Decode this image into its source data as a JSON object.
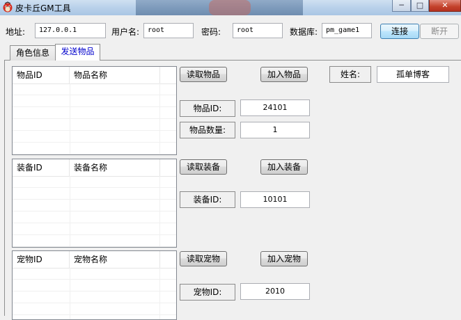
{
  "window": {
    "title": "皮卡丘GM工具",
    "minimize": "─",
    "maximize": "□",
    "close": "✕"
  },
  "connection": {
    "address_label": "地址:",
    "address_value": "127.0.0.1",
    "user_label": "用户名:",
    "user_value": "root",
    "password_label": "密码:",
    "password_value": "root",
    "db_label": "数据库:",
    "db_value": "pm_game1",
    "connect_button": "连接",
    "disconnect_button": "断开"
  },
  "tabs": [
    {
      "label": "角色信息"
    },
    {
      "label": "发送物品"
    }
  ],
  "name": {
    "label": "姓名:",
    "value": "孤单博客"
  },
  "items": {
    "col_id": "物品ID",
    "col_name": "物品名称",
    "read_button": "读取物品",
    "add_button": "加入物品",
    "id_label": "物品ID:",
    "id_value": "24101",
    "qty_label": "物品数量:",
    "qty_value": "1"
  },
  "equipment": {
    "col_id": "装备ID",
    "col_name": "装备名称",
    "read_button": "读取装备",
    "add_button": "加入装备",
    "id_label": "装备ID:",
    "id_value": "10101"
  },
  "pets": {
    "col_id": "宠物ID",
    "col_name": "宠物名称",
    "read_button": "读取宠物",
    "add_button": "加入宠物",
    "id_label": "宠物ID:",
    "id_value": "2010"
  }
}
